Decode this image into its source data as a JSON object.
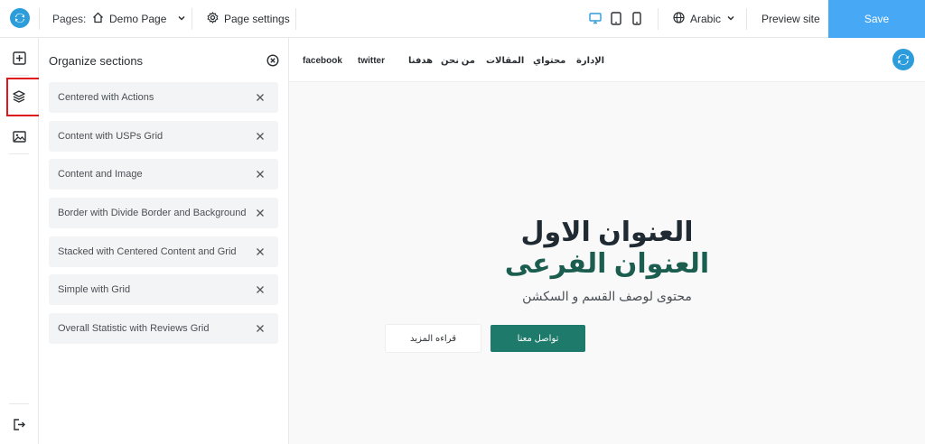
{
  "topbar": {
    "pages_label": "Pages:",
    "current_page": "Demo Page",
    "page_settings_label": "Page settings",
    "language": "Arabic",
    "preview_label": "Preview site",
    "save_label": "Save"
  },
  "panel": {
    "title": "Organize sections",
    "sections": [
      "Centered with Actions",
      "Content with USPs Grid",
      "Content and Image",
      "Border with Divide Border and Background",
      "Stacked with Centered Content and Grid",
      "Simple with Grid",
      "Overall Statistic with Reviews Grid"
    ]
  },
  "site": {
    "nav_links": [
      "facebook",
      "twitter",
      "هدفنا",
      "من نحن",
      "المقالات",
      "محتواي",
      "الإدارة"
    ],
    "hero_title": "العنوان الاول",
    "hero_subtitle": "العنوان الفرعى",
    "hero_description": "محتوى لوصف القسم و السكشن",
    "primary_button": "تواصل معنا",
    "secondary_button": "قراءه المزيد"
  },
  "colors": {
    "accent_blue": "#47a8f5",
    "brand_blue": "#2d9cdb",
    "primary_green": "#1e7a6a",
    "subtitle_green": "#1b5e4f",
    "active_outline": "#e0161b"
  },
  "icons": {
    "rail": [
      "add-section-icon",
      "layers-icon",
      "image-icon",
      "exit-icon"
    ],
    "devices": [
      "desktop-icon",
      "tablet-icon",
      "mobile-icon"
    ]
  }
}
